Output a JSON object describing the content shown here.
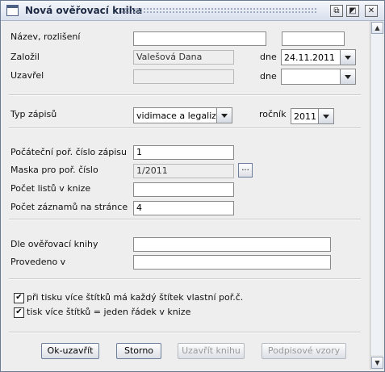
{
  "window": {
    "title": "Nová ověřovací kniha",
    "controls": {
      "iconify": "⧉",
      "maximize": "◩",
      "close": "✕"
    }
  },
  "form": {
    "nazev_label": "Název, rozlišení",
    "zalozil_label": "Založil",
    "zalozil_value": "Valešová Dana",
    "dne_label": "dne",
    "zalozil_date": "24.11.2011",
    "uzavrel_label": "Uzavřel",
    "uzavrel_dne_label": "dne",
    "typ_label": "Typ zápisů",
    "typ_value": "vidimace a legalizace",
    "rocnik_label": "ročník",
    "rocnik_value": "2011",
    "pocatecni_label": "Počáteční poř. číslo zápisu",
    "pocatecni_value": "1",
    "maska_label": "Maska pro poř. číslo",
    "maska_value": "1/2011",
    "maska_button": "...",
    "pocet_listu_label": "Počet listů v knize",
    "pocet_zaznamu_label": "Počet záznamů na stránce",
    "pocet_zaznamu_value": "4",
    "dle_label": "Dle ověřovací knihy",
    "provedeno_label": "Provedeno v"
  },
  "checkboxes": [
    {
      "label": "při tisku více štítků má každý štítek vlastní poř.č.",
      "checked": true
    },
    {
      "label": "tisk více štítků = jeden řádek v knize",
      "checked": true
    }
  ],
  "buttons": {
    "ok": "Ok-uzavřít",
    "storno": "Storno",
    "uzavrit": "Uzavřít knihu",
    "podpisove": "Podpisové vzory"
  },
  "colors": {
    "accent": "#4d6185",
    "window_bg": "#eeeeee",
    "desktop": "#c9d4e4"
  }
}
